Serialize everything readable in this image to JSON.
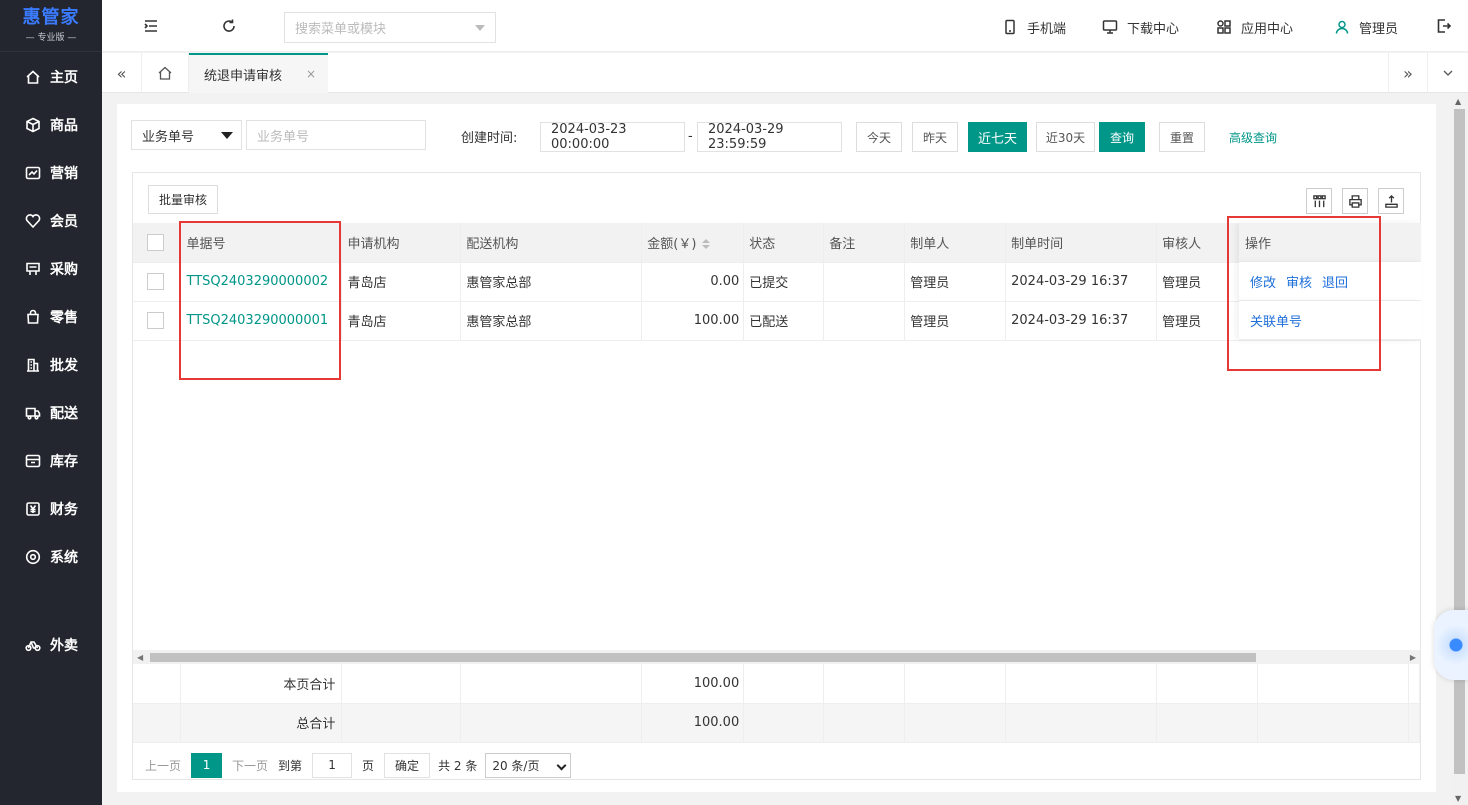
{
  "app": {
    "brand": "惠管家",
    "edition": "— 专业版 —"
  },
  "sidebar": {
    "items": [
      {
        "label": "主页",
        "icon": "home-icon"
      },
      {
        "label": "商品",
        "icon": "box-icon"
      },
      {
        "label": "营销",
        "icon": "chart-icon"
      },
      {
        "label": "会员",
        "icon": "heart-icon"
      },
      {
        "label": "采购",
        "icon": "purchase-icon"
      },
      {
        "label": "零售",
        "icon": "bag-icon"
      },
      {
        "label": "批发",
        "icon": "building-icon"
      },
      {
        "label": "配送",
        "icon": "delivery-icon"
      },
      {
        "label": "库存",
        "icon": "inventory-icon"
      },
      {
        "label": "财务",
        "icon": "finance-icon"
      },
      {
        "label": "系统",
        "icon": "settings-icon"
      },
      {
        "label": "外卖",
        "icon": "bike-icon"
      }
    ]
  },
  "topbar": {
    "search_placeholder": "搜索菜单或模块",
    "mobile": "手机端",
    "download": "下载中心",
    "apps": "应用中心",
    "user": "管理员"
  },
  "tabs": {
    "active": "统退申请审核",
    "close": "×"
  },
  "filter": {
    "type_select": "业务单号",
    "order_placeholder": "业务单号",
    "created_label": "创建时间:",
    "date_start": "2024-03-23 00:00:00",
    "date_sep": "-",
    "date_end": "2024-03-29 23:59:59",
    "btn_today": "今天",
    "btn_yesterday": "昨天",
    "btn_7days": "近七天",
    "btn_30days": "近30天",
    "btn_query": "查询",
    "btn_reset": "重置",
    "advanced": "高级查询"
  },
  "grid": {
    "batch_label": "批量审核",
    "columns": [
      "单据号",
      "申请机构",
      "配送机构",
      "金额(￥)",
      "状态",
      "备注",
      "制单人",
      "制单时间",
      "审核人",
      "操作"
    ],
    "rows": [
      {
        "no": "TTSQ2403290000002",
        "apply": "青岛店",
        "dist": "惠管家总部",
        "amount": "0.00",
        "status": "已提交",
        "note": "",
        "maker": "管理员",
        "time": "2024-03-29 16:37",
        "auditor": "管理员",
        "ops": [
          "修改",
          "审核",
          "退回"
        ]
      },
      {
        "no": "TTSQ2403290000001",
        "apply": "青岛店",
        "dist": "惠管家总部",
        "amount": "100.00",
        "status": "已配送",
        "note": "",
        "maker": "管理员",
        "time": "2024-03-29 16:37",
        "auditor": "管理员",
        "ops": [
          "关联单号"
        ]
      }
    ],
    "page_total_label": "本页合计",
    "page_total": "100.00",
    "grand_total_label": "总合计",
    "grand_total": "100.00"
  },
  "pager": {
    "prev": "上一页",
    "current": "1",
    "next": "下一页",
    "goto": "到第",
    "page_input": "1",
    "page_unit": "页",
    "confirm": "确定",
    "total": "共 2 条",
    "per_page": "20 条/页"
  },
  "colors": {
    "accent": "#009688",
    "sidebar": "#23262e",
    "link": "#1e6fd9",
    "highlight": "#e53935"
  }
}
